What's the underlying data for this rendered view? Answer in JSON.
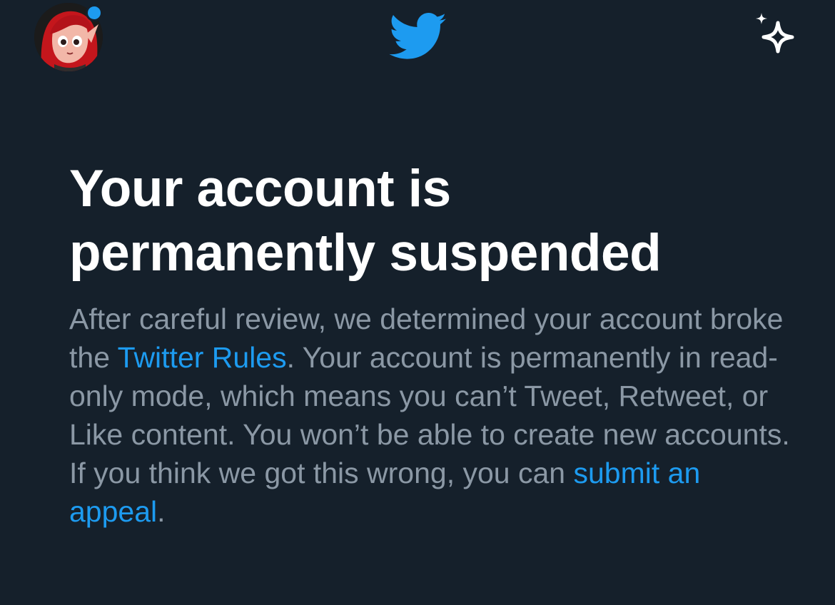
{
  "header": {
    "avatar_icon": "user-avatar",
    "logo_icon": "twitter-bird-icon",
    "sparkle_icon": "sparkle-icon",
    "accent_color": "#1d9bf0",
    "background_color": "#15202b"
  },
  "notice": {
    "title_line1": "Your account is",
    "title_line2": "permanently suspended",
    "body_part1": "After careful review, we determined your account broke the ",
    "rules_link": "Twitter Rules",
    "body_part2": ". Your account is permanently in read-only mode, which means you can’t Tweet, Retweet, or Like content. You won’t be able to create new accounts. If you think we got this wrong, you can ",
    "appeal_link": "submit an appeal",
    "body_end": "."
  }
}
